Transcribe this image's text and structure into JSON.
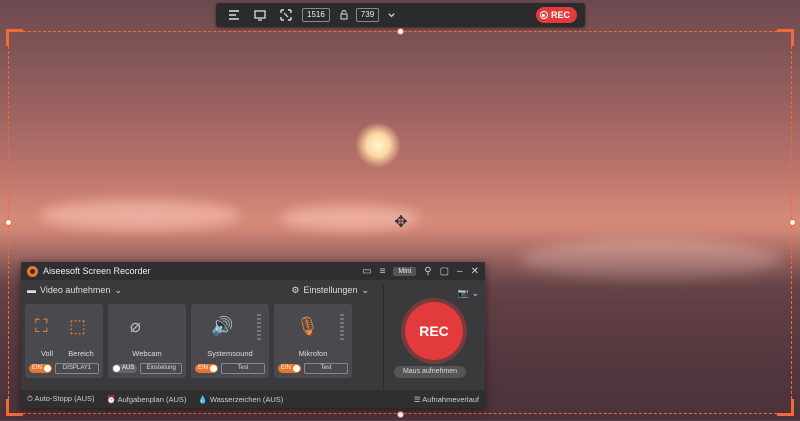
{
  "toolbar": {
    "width": "1516",
    "height": "739",
    "rec_label": "REC"
  },
  "window": {
    "title": "Aiseesoft Screen Recorder",
    "mini_label": "Mini",
    "mode_label": "Video aufnehmen",
    "settings_label": "Einstellungen"
  },
  "cards": {
    "screen": {
      "voll_label": "Voll",
      "bereich_label": "Bereich",
      "toggle_label": "EIN",
      "display_value": "DISPLAY1"
    },
    "webcam": {
      "label": "Webcam",
      "toggle_label": "AUS",
      "settings_button": "Einstellung"
    },
    "systemsound": {
      "label": "Systemsound",
      "toggle_label": "EIN",
      "test_button": "Test"
    },
    "mikrofon": {
      "label": "Mikrofon",
      "toggle_label": "EIN",
      "test_button": "Test"
    }
  },
  "record": {
    "rec_label": "REC",
    "mouse_button": "Maus aufnehmen"
  },
  "status": {
    "auto_stop": "Auto-Stopp (AUS)",
    "schedule": "Aufgabenplan (AUS)",
    "watermark": "Wasserzeichen (AUS)",
    "history": "Aufnahmeverlauf"
  },
  "colors": {
    "accent": "#f26a3a",
    "rec_red": "#e33b3b"
  }
}
